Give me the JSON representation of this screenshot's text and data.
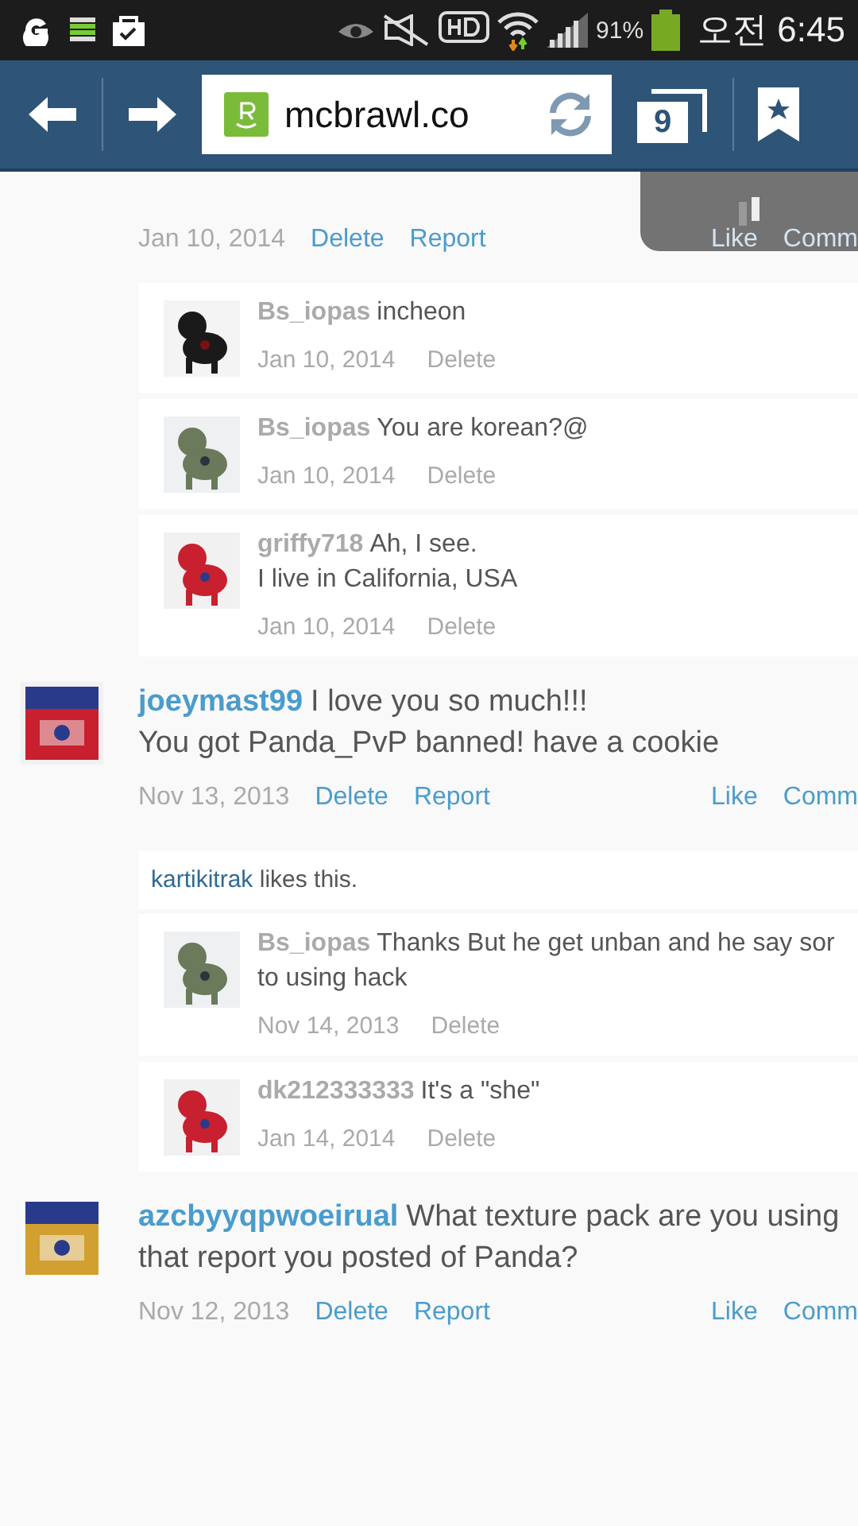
{
  "status_bar": {
    "battery": "91%",
    "time": "오전 6:45"
  },
  "browser": {
    "url": "mcbrawl.co",
    "tab_count": "9"
  },
  "threads": [
    {
      "date": "Jan 10, 2014",
      "actions": [
        "Delete",
        "Report"
      ],
      "social": [
        "Like",
        "Comm"
      ],
      "replies": [
        {
          "author": "Bs_iopas",
          "lines": [
            "incheon"
          ],
          "date": "Jan 10, 2014",
          "action": "Delete"
        },
        {
          "author": "Bs_iopas",
          "lines": [
            "You are korean?@"
          ],
          "date": "Jan 10, 2014",
          "action": "Delete"
        },
        {
          "author": "griffy718",
          "lines": [
            "Ah, I see.",
            "I live in California, USA"
          ],
          "date": "Jan 10, 2014",
          "action": "Delete"
        }
      ]
    },
    {
      "author": "joeymast99",
      "lines": [
        "I love you so much!!!",
        "You got Panda_PvP banned! have a cookie"
      ],
      "date": "Nov 13, 2013",
      "actions": [
        "Delete",
        "Report"
      ],
      "social": [
        "Like",
        "Comm"
      ],
      "likes": {
        "user": "kartikitrak",
        "text": "likes this."
      },
      "replies": [
        {
          "author": "Bs_iopas",
          "lines": [
            "Thanks But he get unban and he say sor",
            "to using hack"
          ],
          "date": "Nov 14, 2013",
          "action": "Delete"
        },
        {
          "author": "dk212333333",
          "lines": [
            "It's a \"she\""
          ],
          "date": "Jan 14, 2014",
          "action": "Delete"
        }
      ]
    },
    {
      "author": "azcbyyqpwoeirual",
      "lines": [
        "What texture pack are you using",
        "that report you posted of Panda?"
      ],
      "date": "Nov 12, 2013",
      "actions": [
        "Delete",
        "Report"
      ],
      "social": [
        "Like",
        "Comm"
      ]
    }
  ]
}
